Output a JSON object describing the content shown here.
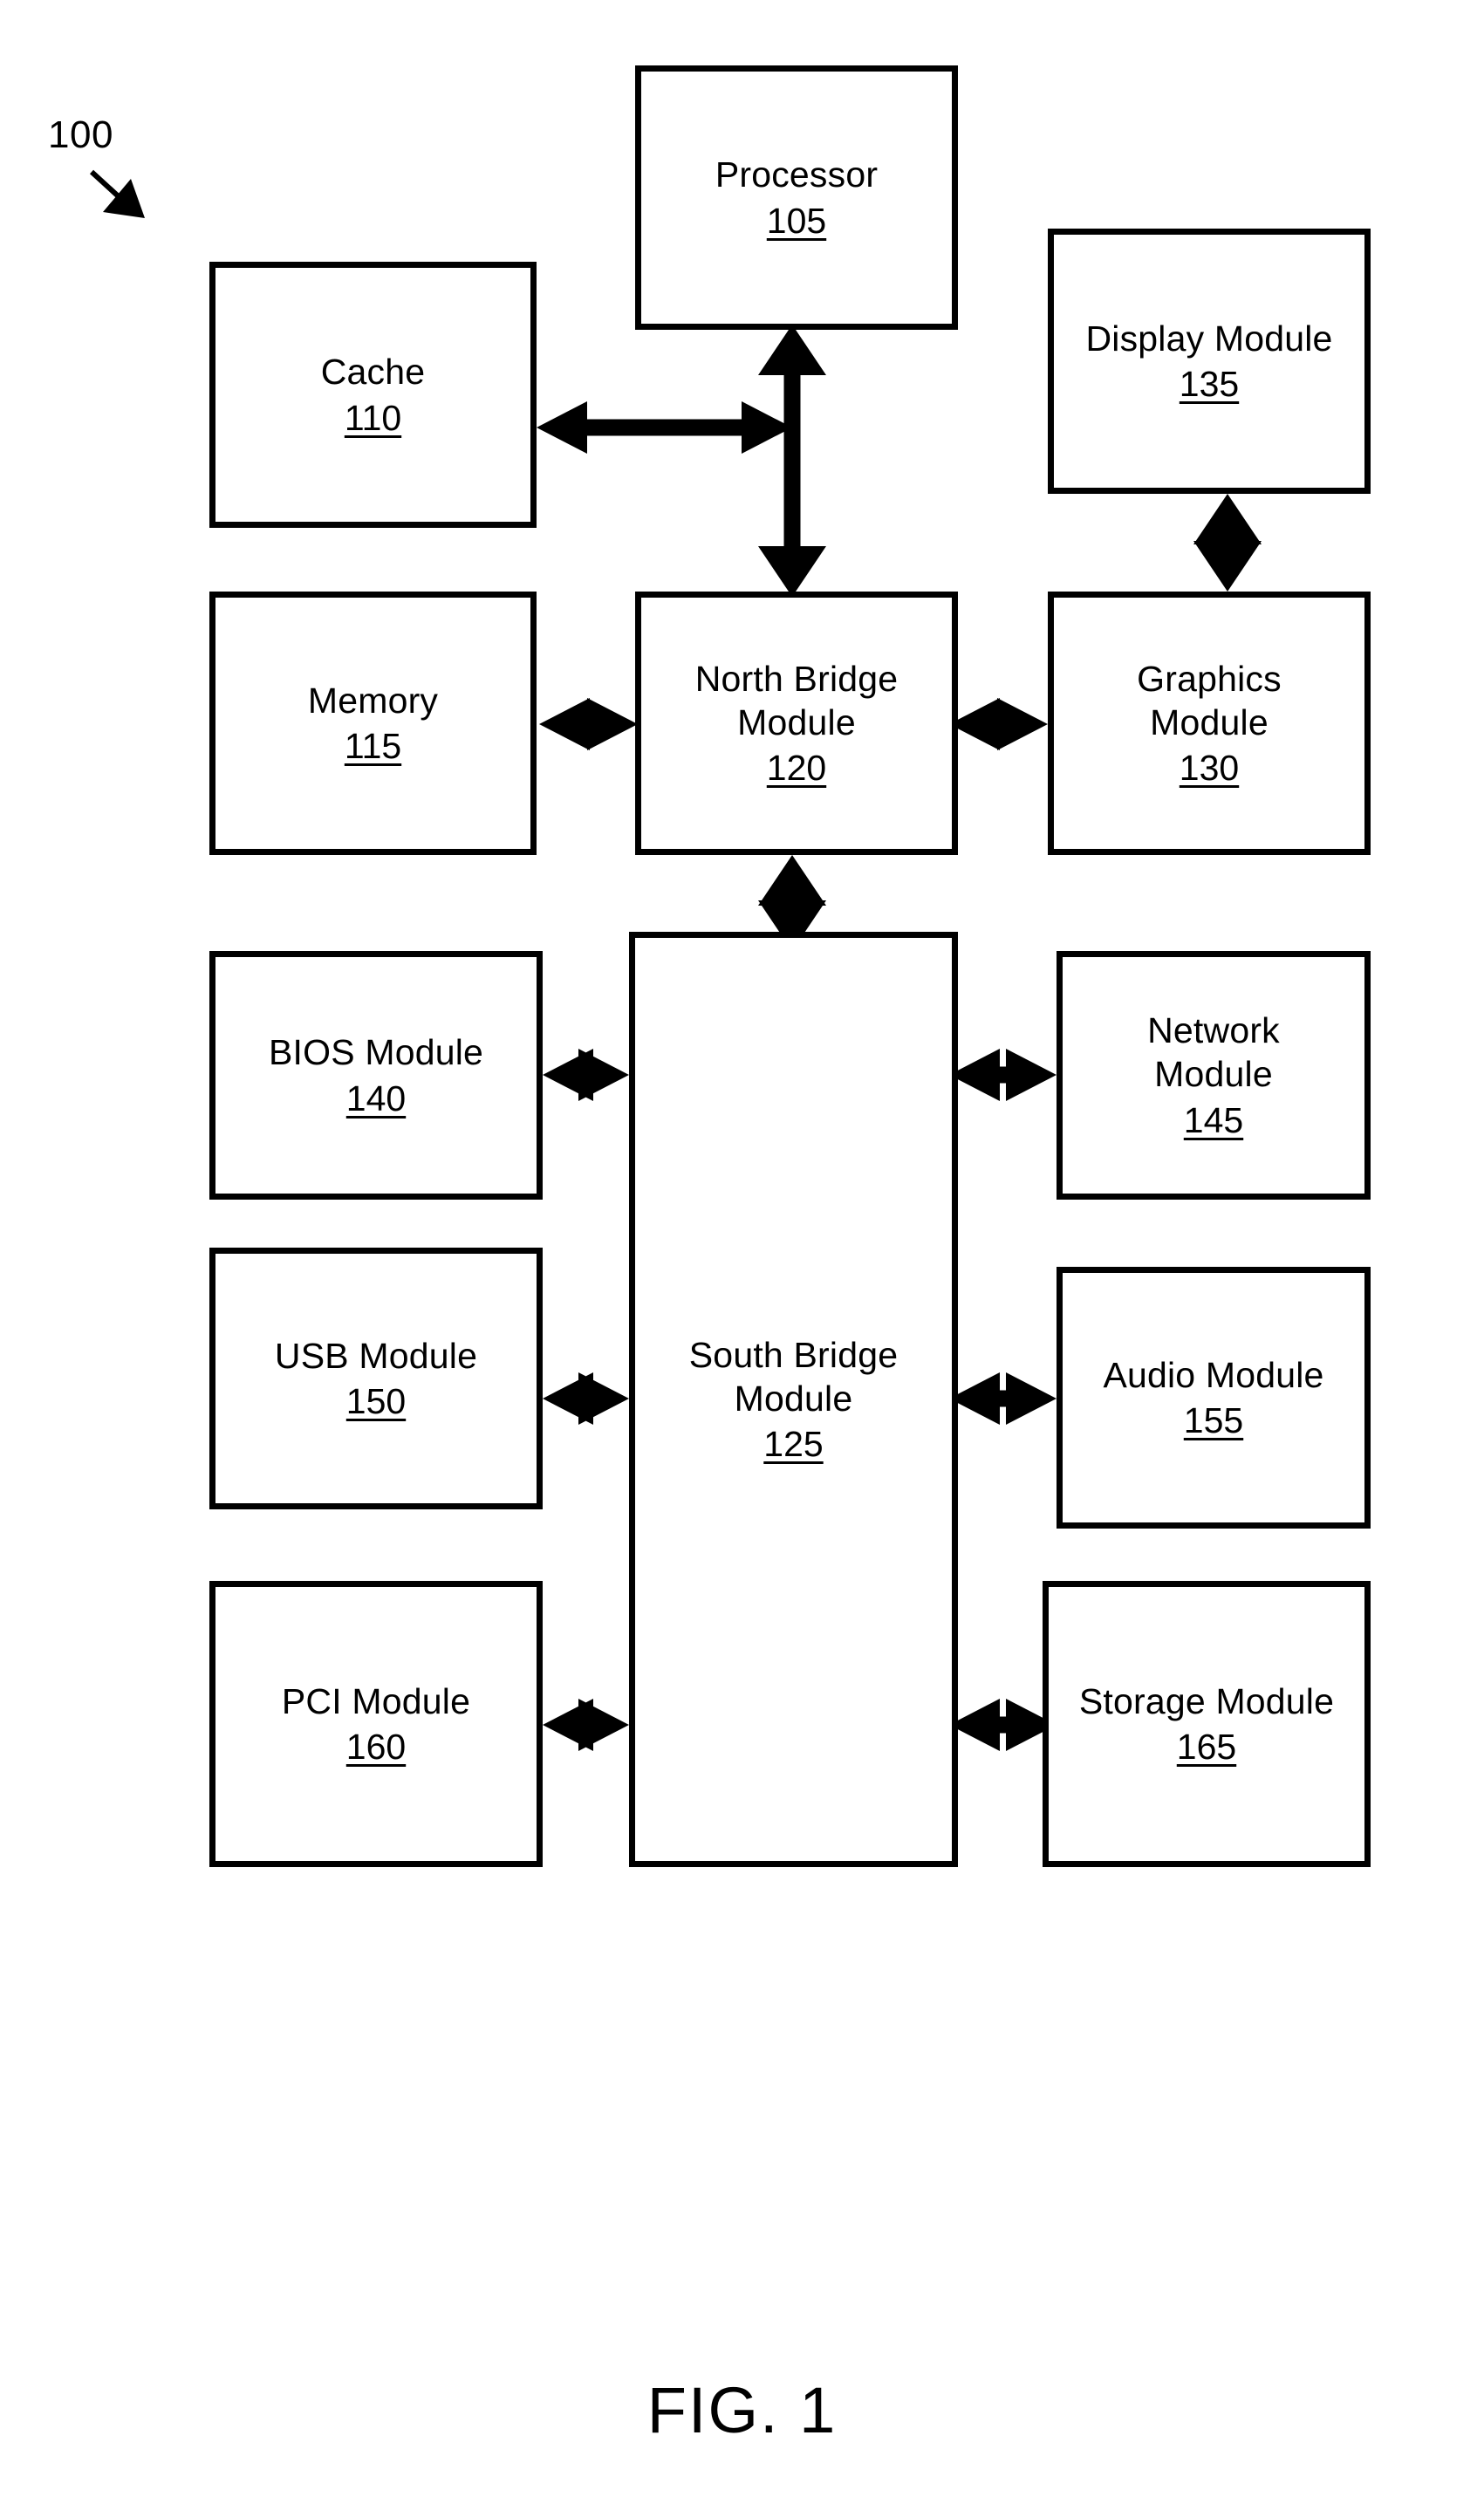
{
  "figure": {
    "reference_numeral": "100",
    "caption": "FIG. 1"
  },
  "blocks": [
    {
      "id": "processor",
      "label": "Processor",
      "ref": "105"
    },
    {
      "id": "cache",
      "label": "Cache",
      "ref": "110"
    },
    {
      "id": "display",
      "label": "Display Module",
      "ref": "135"
    },
    {
      "id": "memory",
      "label": "Memory",
      "ref": "115"
    },
    {
      "id": "north_bridge",
      "label": "North Bridge\nModule",
      "ref": "120"
    },
    {
      "id": "graphics",
      "label": "Graphics\nModule",
      "ref": "130"
    },
    {
      "id": "bios",
      "label": "BIOS Module",
      "ref": "140"
    },
    {
      "id": "network",
      "label": "Network\nModule",
      "ref": "145"
    },
    {
      "id": "usb",
      "label": "USB Module",
      "ref": "150"
    },
    {
      "id": "south_bridge",
      "label": "South Bridge\nModule",
      "ref": "125"
    },
    {
      "id": "audio",
      "label": "Audio Module",
      "ref": "155"
    },
    {
      "id": "pci",
      "label": "PCI Module",
      "ref": "160"
    },
    {
      "id": "storage",
      "label": "Storage Module",
      "ref": "165"
    }
  ],
  "connections": [
    {
      "from": "cache",
      "to": "processor_bus",
      "style": "double-arrow",
      "orientation": "horizontal"
    },
    {
      "from": "processor",
      "to": "north_bridge",
      "style": "double-arrow",
      "orientation": "vertical"
    },
    {
      "from": "memory",
      "to": "north_bridge",
      "style": "double-arrow",
      "orientation": "horizontal"
    },
    {
      "from": "north_bridge",
      "to": "graphics",
      "style": "double-arrow",
      "orientation": "horizontal"
    },
    {
      "from": "display",
      "to": "graphics",
      "style": "double-arrow",
      "orientation": "vertical"
    },
    {
      "from": "north_bridge",
      "to": "south_bridge",
      "style": "double-arrow",
      "orientation": "vertical"
    },
    {
      "from": "bios",
      "to": "south_bridge",
      "style": "double-arrow",
      "orientation": "horizontal"
    },
    {
      "from": "south_bridge",
      "to": "network",
      "style": "double-arrow",
      "orientation": "horizontal"
    },
    {
      "from": "usb",
      "to": "south_bridge",
      "style": "double-arrow",
      "orientation": "horizontal"
    },
    {
      "from": "south_bridge",
      "to": "audio",
      "style": "double-arrow",
      "orientation": "horizontal"
    },
    {
      "from": "pci",
      "to": "south_bridge",
      "style": "double-arrow",
      "orientation": "horizontal"
    },
    {
      "from": "south_bridge",
      "to": "storage",
      "style": "double-arrow",
      "orientation": "horizontal"
    }
  ],
  "colors": {
    "stroke": "#000000",
    "background": "#ffffff"
  }
}
